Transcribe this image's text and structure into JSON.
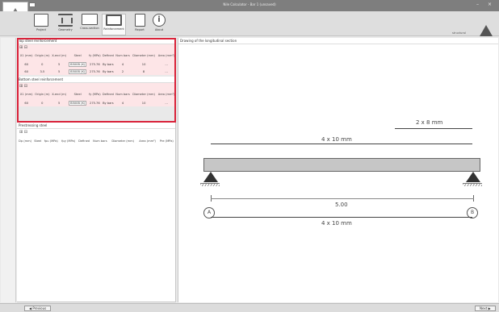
{
  "window": {
    "title": "Nile Calculator - Bar 1 (unsaved)",
    "min": "–",
    "close": "×"
  },
  "toolbar": {
    "items": [
      {
        "label": "Project"
      },
      {
        "label": "Geometry"
      },
      {
        "label": "Cross-section"
      },
      {
        "label": "Reinforcement"
      },
      {
        "label": "Report"
      },
      {
        "label": "About"
      }
    ],
    "info_icon": "i",
    "right_text": "structural"
  },
  "top_steel": {
    "title": "Top steel reinforcement",
    "tools": "⊞ ⊟",
    "headers": [
      "",
      "X1 (mm)",
      "Origin (m)",
      "X-end (m)",
      "Steel",
      "fy (MPa)",
      "Defined",
      "Num bars",
      "Diameter (mm)",
      "Area (mm²)"
    ],
    "rows": [
      [
        "1",
        "60",
        "0",
        "5",
        "B500B (K)",
        "275.76",
        "By bars",
        "4",
        "10",
        "..."
      ],
      [
        "2",
        "60",
        "3.5",
        "5",
        "B500B (K)",
        "275.76",
        "By bars",
        "2",
        "8",
        "..."
      ]
    ]
  },
  "bottom_steel": {
    "title": "Bottom steel reinforcement",
    "tools": "⊞ ⊟",
    "headers": [
      "",
      "X1 (mm)",
      "Origin (m)",
      "X-end (m)",
      "Steel",
      "fy (MPa)",
      "Defined",
      "Num bars",
      "Diameter (mm)",
      "Area (mm²)"
    ],
    "rows": [
      [
        "1",
        "60",
        "0",
        "5",
        "B500B (K)",
        "275.76",
        "By bars",
        "4",
        "10",
        "..."
      ]
    ]
  },
  "prestress": {
    "title": "Prestressing steel",
    "tools": "⊞ ⊟",
    "headers": [
      "Dp (mm)",
      "Steel",
      "fpu (MPa)",
      "fpy (MPa)",
      "Defined",
      "Num bars",
      "Diameter (mm)",
      "Area (mm²)",
      "Pre (MPa)"
    ]
  },
  "drawing": {
    "title": "Drawing of the longitudinal section",
    "top_label": "2 x 8 mm",
    "mid_label": "4 x 10 mm",
    "span_label": "5.00",
    "bottom_label": "4 x 10 mm",
    "support_a": "A",
    "support_b": "B"
  },
  "status": {
    "prev": "◀ Previous",
    "next": "Next ▶"
  }
}
